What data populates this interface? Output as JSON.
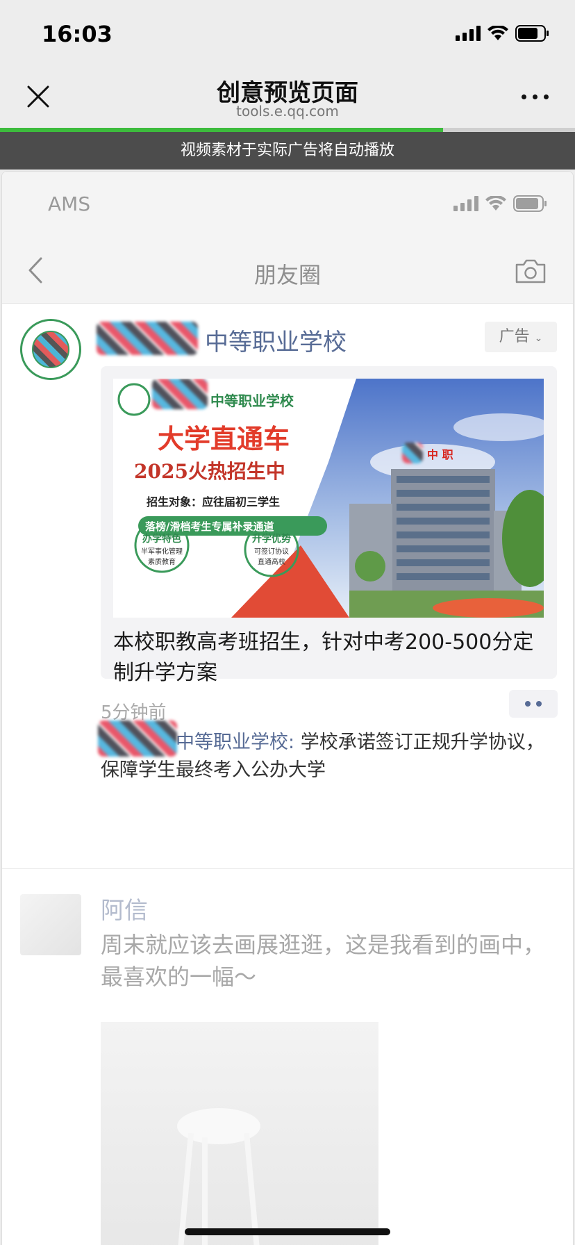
{
  "status_bar": {
    "time": "16:03"
  },
  "browser": {
    "title": "创意预览页面",
    "url": "tools.e.qq.com",
    "progress": 0.77,
    "notice": "视频素材于实际广告将自动播放"
  },
  "preview": {
    "carrier": "AMS",
    "nav_title": "朋友圈"
  },
  "ad_post": {
    "name": "中等职业学校",
    "badge": "广告",
    "image": {
      "school": "中等职业学校",
      "headline": "大学直通车",
      "subheadline": "2025火热招生中",
      "target": "招生对象：应往届初三学生",
      "banner": "落榜/滑档考生专属补录通道",
      "seal1_title": "办学特色",
      "seal1_line1": "半军事化管理",
      "seal1_line2": "素质教育",
      "seal2_title": "升学优势",
      "seal2_line1": "可签订协议",
      "seal2_line2": "直通高校",
      "building_sign": "中 职"
    },
    "caption": "本校职教高考班招生，针对中考200-500分定制升学方案",
    "time": "5分钟前",
    "comment_author": "中等职业学校",
    "comment_sep": ":",
    "comment_text": " 学校承诺签订正规升学协议，保障学生最终考入公办大学"
  },
  "friend_post": {
    "name": "阿信",
    "text": "周末就应该去画展逛逛，这是我看到的画中，最喜欢的一幅～"
  }
}
